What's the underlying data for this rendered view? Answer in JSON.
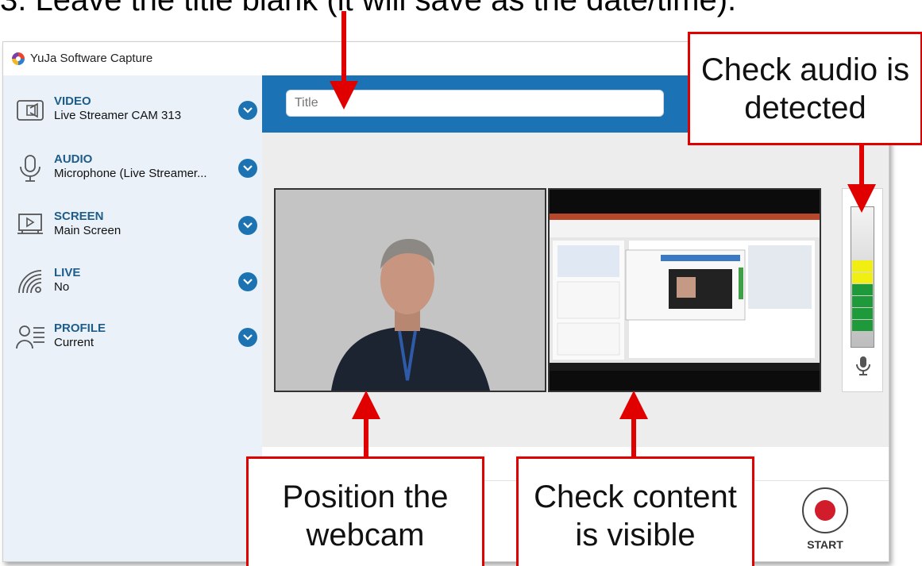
{
  "caption": "3. Leave the title blank (it will save as the date/time).",
  "app": {
    "title": "YuJa Software Capture"
  },
  "sidebar": {
    "items": [
      {
        "heading": "VIDEO",
        "value": "Live Streamer CAM 313",
        "icon": "camera-icon"
      },
      {
        "heading": "AUDIO",
        "value": "Microphone (Live Streamer...",
        "icon": "microphone-icon"
      },
      {
        "heading": "SCREEN",
        "value": "Main Screen",
        "icon": "screen-icon"
      },
      {
        "heading": "LIVE",
        "value": "No",
        "icon": "broadcast-icon"
      },
      {
        "heading": "PROFILE",
        "value": "Current",
        "icon": "profile-icon"
      }
    ]
  },
  "title_field": {
    "placeholder": "Title",
    "value": ""
  },
  "start_button": {
    "label": "START"
  },
  "callouts": {
    "audio": "Check audio is detected",
    "webcam": "Position the webcam",
    "content": "Check content is visible"
  },
  "colors": {
    "accent": "#1b73b5",
    "callout_border": "#e00000",
    "record": "#d11c2b",
    "meter_green": "#1f9a3a",
    "meter_yellow": "#f1ee12"
  },
  "audio_meter": {
    "level": 0.48
  }
}
